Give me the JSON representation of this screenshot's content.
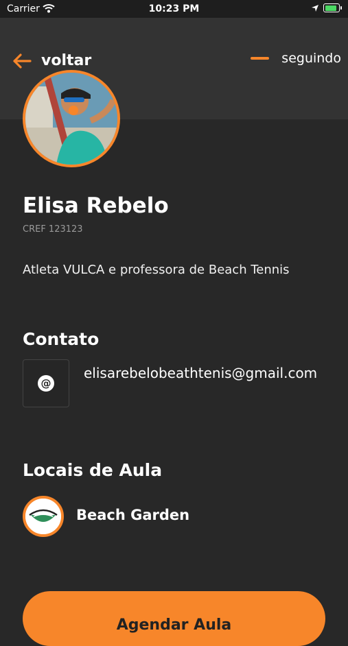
{
  "status_bar": {
    "carrier": "Carrier",
    "time": "10:23 PM"
  },
  "header": {
    "back_label": "voltar",
    "follow_label": "seguindo"
  },
  "profile": {
    "name": "Elisa Rebelo",
    "cref": "CREF 123123",
    "bio": "Atleta VULCA e professora de Beach Tennis"
  },
  "contact": {
    "title": "Contato",
    "at_symbol": "@",
    "email": "elisarebelobeathtenis@gmail.com"
  },
  "locais": {
    "title": "Locais de Aula",
    "places": [
      {
        "name": "Beach Garden"
      }
    ]
  },
  "cta": {
    "label": "Agendar Aula"
  },
  "colors": {
    "accent": "#f7862a",
    "background": "#282828",
    "header": "#333333"
  }
}
